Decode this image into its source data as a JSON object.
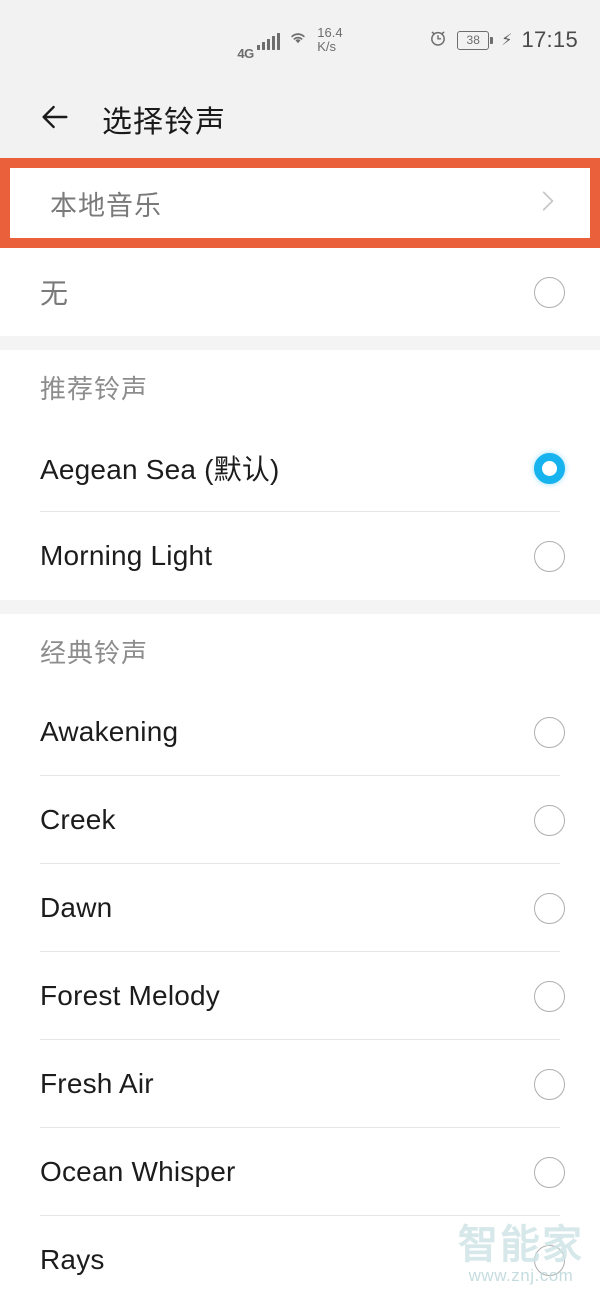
{
  "statusbar": {
    "network_type": "4G",
    "signal_icon": "signal-bars-icon",
    "wifi_icon": "wifi-icon",
    "speed_value": "16.4",
    "speed_unit": "K/s",
    "alarm_icon": "alarm-clock-icon",
    "battery_level": "38",
    "charging_icon": "lightning-bolt-icon",
    "time": "17:15"
  },
  "appbar": {
    "back_icon": "back-arrow-icon",
    "title": "选择铃声"
  },
  "local_music": {
    "label": "本地音乐",
    "chevron_icon": "chevron-right-icon",
    "highlight_color": "#e9603b"
  },
  "none_row": {
    "label": "无",
    "selected": false
  },
  "sections": [
    {
      "title": "推荐铃声",
      "items": [
        {
          "label": "Aegean Sea (默认)",
          "selected": true
        },
        {
          "label": "Morning Light",
          "selected": false
        }
      ]
    },
    {
      "title": "经典铃声",
      "items": [
        {
          "label": "Awakening",
          "selected": false
        },
        {
          "label": "Creek",
          "selected": false
        },
        {
          "label": "Dawn",
          "selected": false
        },
        {
          "label": "Forest Melody",
          "selected": false
        },
        {
          "label": "Fresh Air",
          "selected": false
        },
        {
          "label": "Ocean Whisper",
          "selected": false
        },
        {
          "label": "Rays",
          "selected": false
        }
      ]
    }
  ],
  "colors": {
    "accent_selected": "#17b3ef",
    "highlight_box": "#e9603b",
    "chrome_bg": "#f2f2f2"
  },
  "watermark": {
    "brand": "智能家",
    "url": "www.znj.com"
  }
}
